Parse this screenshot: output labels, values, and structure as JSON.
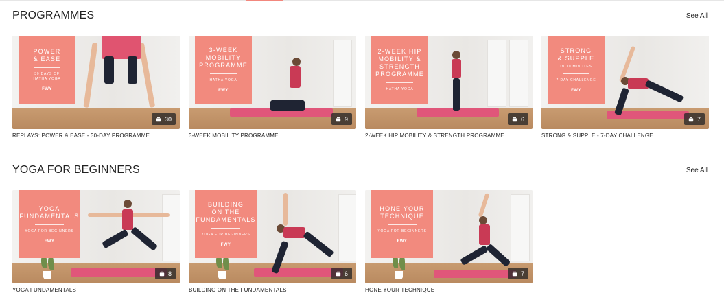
{
  "colors": {
    "accent": "#f28a7e",
    "mat": "#e0567a",
    "badge_bg": "#2a2727"
  },
  "sections": [
    {
      "title": "PROGRAMMES",
      "see_all": "See All",
      "cards": [
        {
          "overlay_title": "POWER\n& EASE",
          "overlay_sub": "30 DAYS OF\nHATHA YOGA",
          "logo": "FWY",
          "count": "30",
          "title": "REPLAYS: POWER & EASE - 30-DAY PROGRAMME",
          "icon": "video-stack-icon"
        },
        {
          "overlay_title": "3-WEEK\nMOBILITY\nPROGRAMME",
          "overlay_sub": "HATHA YOGA",
          "logo": "FWY",
          "count": "9",
          "title": "3-WEEK MOBILITY PROGRAMME",
          "icon": "video-stack-icon"
        },
        {
          "overlay_title": "2-WEEK HIP\nMOBILITY &\nSTRENGTH\nPROGRAMME",
          "overlay_sub": "HATHA YOGA",
          "logo": "FWY",
          "count": "6",
          "title": "2-WEEK HIP MOBILITY & STRENGTH PROGRAMME",
          "icon": "video-stack-icon"
        },
        {
          "overlay_title": "STRONG\n& SUPPLE",
          "overlay_note": "IN 10 MINUTES",
          "overlay_sub": "7-DAY CHALLENGE",
          "logo": "FWY",
          "count": "7",
          "title": "STRONG & SUPPLE - 7-DAY CHALLENGE",
          "icon": "video-stack-icon"
        }
      ]
    },
    {
      "title": "YOGA FOR BEGINNERS",
      "see_all": "See All",
      "cards": [
        {
          "overlay_title": "YOGA\nFUNDAMENTALS",
          "overlay_sub": "YOGA FOR BEGINNERS",
          "logo": "FWY",
          "count": "8",
          "title": "YOGA FUNDAMENTALS",
          "icon": "video-stack-icon"
        },
        {
          "overlay_title": "BUILDING\nON THE\nFUNDAMENTALS",
          "overlay_sub": "YOGA FOR BEGINNERS",
          "logo": "FWY",
          "count": "6",
          "title": "BUILDING ON THE FUNDAMENTALS",
          "icon": "video-stack-icon"
        },
        {
          "overlay_title": "HONE YOUR\nTECHNIQUE",
          "overlay_sub": "YOGA FOR BEGINNERS",
          "logo": "FWY",
          "count": "7",
          "title": "HONE YOUR TECHNIQUE",
          "icon": "video-stack-icon"
        }
      ]
    }
  ]
}
